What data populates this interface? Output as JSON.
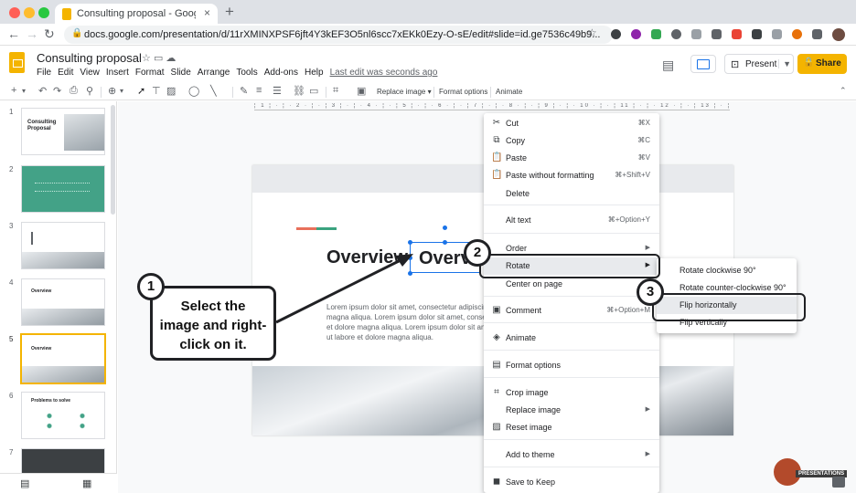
{
  "browser": {
    "tab_title": "Consulting proposal - Google S",
    "tab_close": "×",
    "new_tab": "+",
    "url": "docs.google.com/presentation/d/11rXMINXPSF6jft4Y3kEF3O5nl6scc7xEKk0Ezy-O-sE/edit#slide=id.ge7536c49b9...",
    "traffic_colors": [
      "#ff5f57",
      "#febc2e",
      "#28c840"
    ]
  },
  "docs": {
    "title": "Consulting proposal",
    "menu": [
      "File",
      "Edit",
      "View",
      "Insert",
      "Format",
      "Slide",
      "Arrange",
      "Tools",
      "Add-ons",
      "Help"
    ],
    "last_edit": "Last edit was seconds ago",
    "present_label": "Present",
    "share_label": "Share"
  },
  "toolbar": {
    "replace_image": "Replace image ▾",
    "format_options": "Format options",
    "animate": "Animate"
  },
  "filmstrip": {
    "slide_numbers": [
      "1",
      "2",
      "3",
      "4",
      "5",
      "6",
      "7"
    ],
    "slide1_title": "Consulting Proposal",
    "slide5_title": "Overview",
    "slide6_title": "Problems to solve",
    "selected_slide": "5"
  },
  "slide": {
    "title": "Overview",
    "selected_text": "Overvi",
    "body_lines": [
      "Lorem ipsum dolor sit amet, consectetur adipiscing",
      "magna aliqua. Lorem ipsum dolor sit amet, consect",
      "et dolore magna aliqua. Lorem ipsum dolor sit ame",
      "ut labore et dolore magna aliqua."
    ]
  },
  "context_menu": {
    "items": [
      {
        "label": "Cut",
        "shortcut": "⌘X",
        "icon": "cut-icon"
      },
      {
        "label": "Copy",
        "shortcut": "⌘C",
        "icon": "copy-icon"
      },
      {
        "label": "Paste",
        "shortcut": "⌘V",
        "icon": "paste-icon"
      },
      {
        "label": "Paste without formatting",
        "shortcut": "⌘+Shift+V",
        "icon": "paste-plain-icon"
      },
      {
        "label": "Delete",
        "shortcut": "",
        "icon": ""
      },
      {
        "label": "Alt text",
        "shortcut": "⌘+Option+Y",
        "icon": ""
      },
      {
        "label": "Order",
        "shortcut": "",
        "icon": ""
      },
      {
        "label": "Rotate",
        "shortcut": "",
        "icon": ""
      },
      {
        "label": "Center on page",
        "shortcut": "",
        "icon": ""
      },
      {
        "label": "Comment",
        "shortcut": "⌘+Option+M",
        "icon": "comment-icon"
      },
      {
        "label": "Animate",
        "shortcut": "",
        "icon": "animate-icon"
      },
      {
        "label": "Format options",
        "shortcut": "",
        "icon": "format-icon"
      },
      {
        "label": "Crop image",
        "shortcut": "",
        "icon": "crop-icon"
      },
      {
        "label": "Replace image",
        "shortcut": "",
        "icon": ""
      },
      {
        "label": "Reset image",
        "shortcut": "",
        "icon": "reset-icon"
      },
      {
        "label": "Add to theme",
        "shortcut": "",
        "icon": ""
      },
      {
        "label": "Save to Keep",
        "shortcut": "",
        "icon": "keep-icon"
      }
    ]
  },
  "rotate_submenu": {
    "items": [
      "Rotate clockwise 90°",
      "Rotate counter-clockwise 90°",
      "Flip horizontally",
      "Flip vertically"
    ]
  },
  "annotations": {
    "callout_lines": [
      "Select the",
      "image and right-",
      "click on it."
    ],
    "badges": [
      "1",
      "2",
      "3"
    ]
  },
  "watermark": "PRESENTATIONS"
}
